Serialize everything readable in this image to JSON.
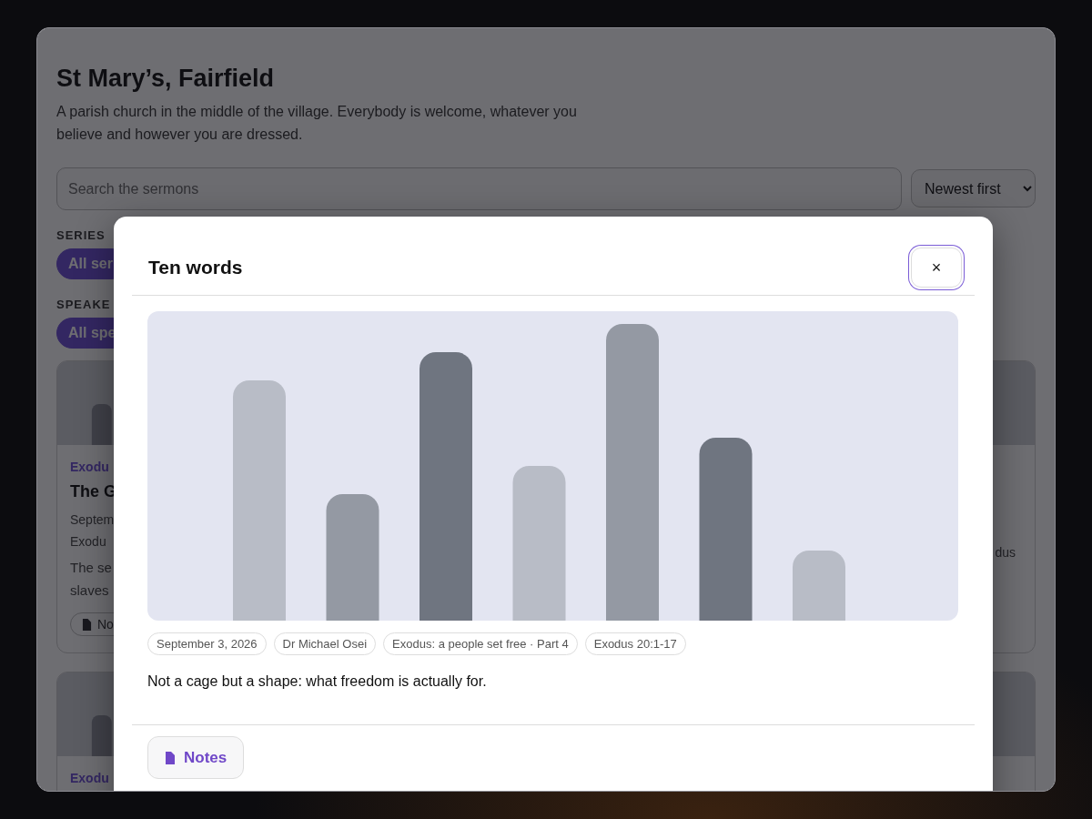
{
  "page": {
    "title": "St Mary’s, Fairfield",
    "description": "A parish church in the middle of the village. Everybody is welcome, whatever you believe and however you are dressed.",
    "search": {
      "placeholder": "Search the sermons"
    },
    "sort": {
      "value": "Newest first"
    },
    "filters": [
      {
        "label": "SERIES",
        "chips": [
          {
            "label": "All ser",
            "selected": true
          }
        ]
      },
      {
        "label": "SPEAKE",
        "chips": [
          {
            "label": "All spe",
            "selected": true
          }
        ]
      }
    ],
    "cards": [
      {
        "thumbnail": {
          "kind": "picture"
        },
        "series": "Exodu",
        "title": "The G",
        "meta": [
          "Septem",
          "Exodu"
        ],
        "summary": [
          "The se",
          "slaves"
        ],
        "notes_button": "No"
      },
      {
        "thumbnail": {
          "kind": "picture"
        },
        "meta": [
          "dus"
        ]
      },
      {
        "thumbnail": {
          "kind": "picture"
        },
        "series": "Exodu"
      },
      {
        "thumbnail": {
          "kind": "picture"
        }
      }
    ]
  },
  "modal": {
    "title": "Ten words",
    "close_button": "×",
    "chips": [
      "September 3, 2026",
      "Dr Michael Osei",
      "Exodus: a people set free · Part 4",
      "Exodus 20:1-17"
    ],
    "description": "Not a cage but a shape: what freedom is actually for.",
    "notes_button": "Notes"
  }
}
